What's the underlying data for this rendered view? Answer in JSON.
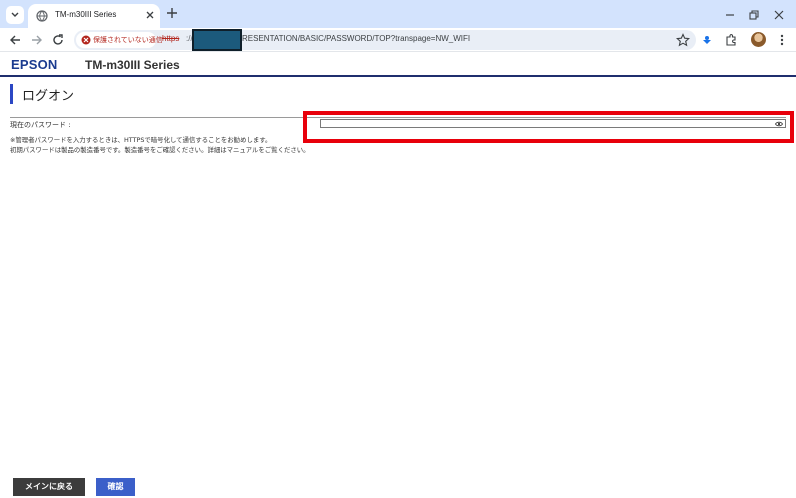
{
  "browser": {
    "tab_title": "TM-m30III Series",
    "security_label": "保護されていない通信",
    "url_scheme": "https",
    "url_separator": "://",
    "url_path": "RESENTATION/BASIC/PASSWORD/TOP?transpage=NW_WIFI"
  },
  "header": {
    "brand": "EPSON",
    "model": "TM-m30III Series"
  },
  "page": {
    "title": "ログオン",
    "password_label": "現在のパスワード :",
    "password_value": "",
    "note_1": "※管理者パスワードを入力するときは、HTTPSで暗号化して通信することをお勧めします。",
    "note_2": "初期パスワードは製品の製造番号です。製造番号をご確認ください。詳細はマニュアルをご覧ください。"
  },
  "buttons": {
    "back": "メインに戻る",
    "confirm": "確認"
  },
  "colors": {
    "tabstrip": "#d3e3fd",
    "brand_blue": "#1a3b8f",
    "title_accent": "#2b47c4",
    "highlight_red": "#e8000b",
    "confirm_button": "#3b5fc9",
    "back_button": "#3c3c3c"
  }
}
